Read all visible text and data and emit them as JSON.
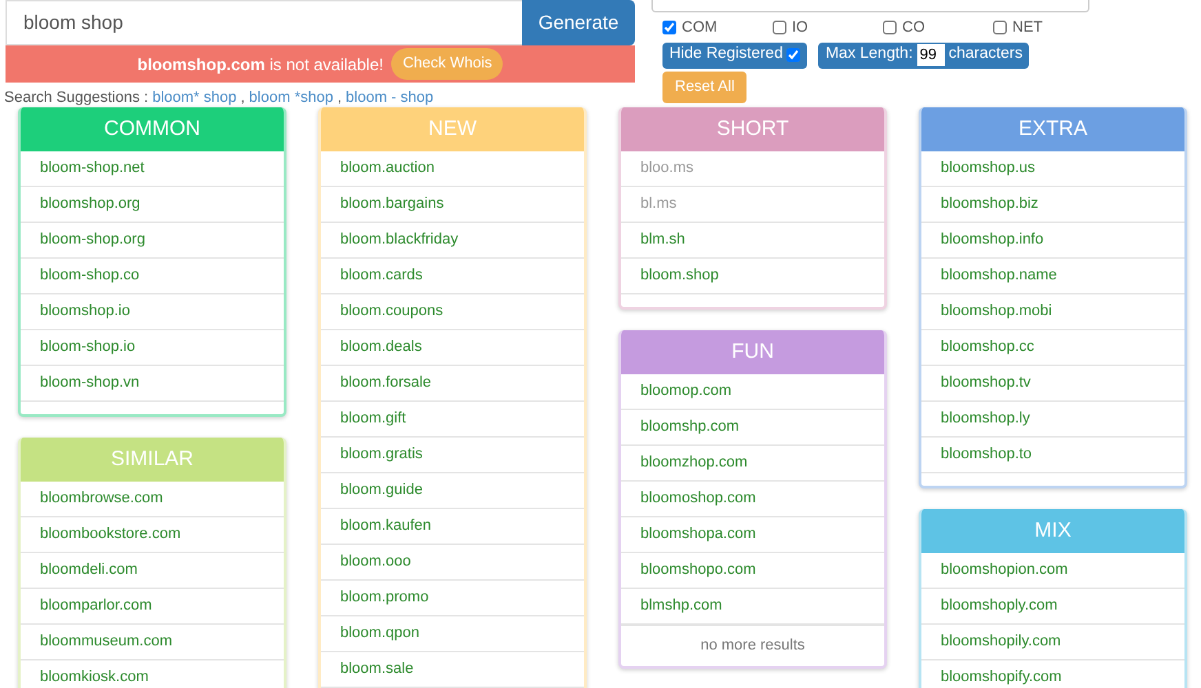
{
  "search": {
    "value": "bloom shop",
    "button": "Generate"
  },
  "alert": {
    "message": "**bloomshop.com** is not available!",
    "button": "Check Whois"
  },
  "suggestions": {
    "label": "Search Suggestions :",
    "separator": ",",
    "links": [
      "bloom* shop",
      "bloom *shop",
      "bloom - shop"
    ]
  },
  "extensions": [
    {
      "label": "COM",
      "checked": true
    },
    {
      "label": "IO",
      "checked": false
    },
    {
      "label": "CO",
      "checked": false
    },
    {
      "label": "NET",
      "checked": false
    }
  ],
  "hide_registered": {
    "label": "Hide Registered",
    "checked": true
  },
  "max_length": {
    "label": "Max Length:",
    "value": "99",
    "unit": "characters"
  },
  "reset_button": "Reset All",
  "columns": [
    {
      "cards": [
        {
          "title": "COMMON",
          "color": "#1dcf7b",
          "items": [
            {
              "text": "bloom-shop.net",
              "available": true
            },
            {
              "text": "bloomshop.org",
              "available": true
            },
            {
              "text": "bloom-shop.org",
              "available": true
            },
            {
              "text": "bloom-shop.co",
              "available": true
            },
            {
              "text": "bloomshop.io",
              "available": true
            },
            {
              "text": "bloom-shop.io",
              "available": true
            },
            {
              "text": "bloom-shop.vn",
              "available": true
            }
          ]
        },
        {
          "title": "SIMILAR",
          "color": "#c5e283",
          "items": [
            {
              "text": "bloombrowse.com",
              "available": true
            },
            {
              "text": "bloombookstore.com",
              "available": true
            },
            {
              "text": "bloomdeli.com",
              "available": true
            },
            {
              "text": "bloomparlor.com",
              "available": true
            },
            {
              "text": "bloommuseum.com",
              "available": true
            },
            {
              "text": "bloomkiosk.com",
              "available": true
            }
          ]
        }
      ]
    },
    {
      "cards": [
        {
          "title": "NEW",
          "color": "#fed27b",
          "items": [
            {
              "text": "bloom.auction",
              "available": true
            },
            {
              "text": "bloom.bargains",
              "available": true
            },
            {
              "text": "bloom.blackfriday",
              "available": true
            },
            {
              "text": "bloom.cards",
              "available": true
            },
            {
              "text": "bloom.coupons",
              "available": true
            },
            {
              "text": "bloom.deals",
              "available": true
            },
            {
              "text": "bloom.forsale",
              "available": true
            },
            {
              "text": "bloom.gift",
              "available": true
            },
            {
              "text": "bloom.gratis",
              "available": true
            },
            {
              "text": "bloom.guide",
              "available": true
            },
            {
              "text": "bloom.kaufen",
              "available": true
            },
            {
              "text": "bloom.ooo",
              "available": true
            },
            {
              "text": "bloom.promo",
              "available": true
            },
            {
              "text": "bloom.qpon",
              "available": true
            },
            {
              "text": "bloom.sale",
              "available": true
            }
          ]
        }
      ]
    },
    {
      "cards": [
        {
          "title": "SHORT",
          "color": "#db9dbe",
          "items": [
            {
              "text": "bloo.ms",
              "available": false
            },
            {
              "text": "bl.ms",
              "available": false
            },
            {
              "text": "blm.sh",
              "available": true
            },
            {
              "text": "bloom.shop",
              "available": true
            }
          ]
        },
        {
          "title": "FUN",
          "color": "#c59bdf",
          "items": [
            {
              "text": "bloomop.com",
              "available": true
            },
            {
              "text": "bloomshp.com",
              "available": true
            },
            {
              "text": "bloomzhop.com",
              "available": true
            },
            {
              "text": "bloomoshop.com",
              "available": true
            },
            {
              "text": "bloomshopa.com",
              "available": true
            },
            {
              "text": "bloomshopo.com",
              "available": true
            },
            {
              "text": "blmshp.com",
              "available": true
            }
          ],
          "footer": "no more results"
        }
      ]
    },
    {
      "cards": [
        {
          "title": "EXTRA",
          "color": "#6c9fe2",
          "items": [
            {
              "text": "bloomshop.us",
              "available": true
            },
            {
              "text": "bloomshop.biz",
              "available": true
            },
            {
              "text": "bloomshop.info",
              "available": true
            },
            {
              "text": "bloomshop.name",
              "available": true
            },
            {
              "text": "bloomshop.mobi",
              "available": true
            },
            {
              "text": "bloomshop.cc",
              "available": true
            },
            {
              "text": "bloomshop.tv",
              "available": true
            },
            {
              "text": "bloomshop.ly",
              "available": true
            },
            {
              "text": "bloomshop.to",
              "available": true
            }
          ]
        },
        {
          "title": "MIX",
          "color": "#5ec3e5",
          "items": [
            {
              "text": "bloomshopion.com",
              "available": true
            },
            {
              "text": "bloomshoply.com",
              "available": true
            },
            {
              "text": "bloomshopily.com",
              "available": true
            },
            {
              "text": "bloomshopify.com",
              "available": true
            }
          ]
        }
      ]
    }
  ]
}
